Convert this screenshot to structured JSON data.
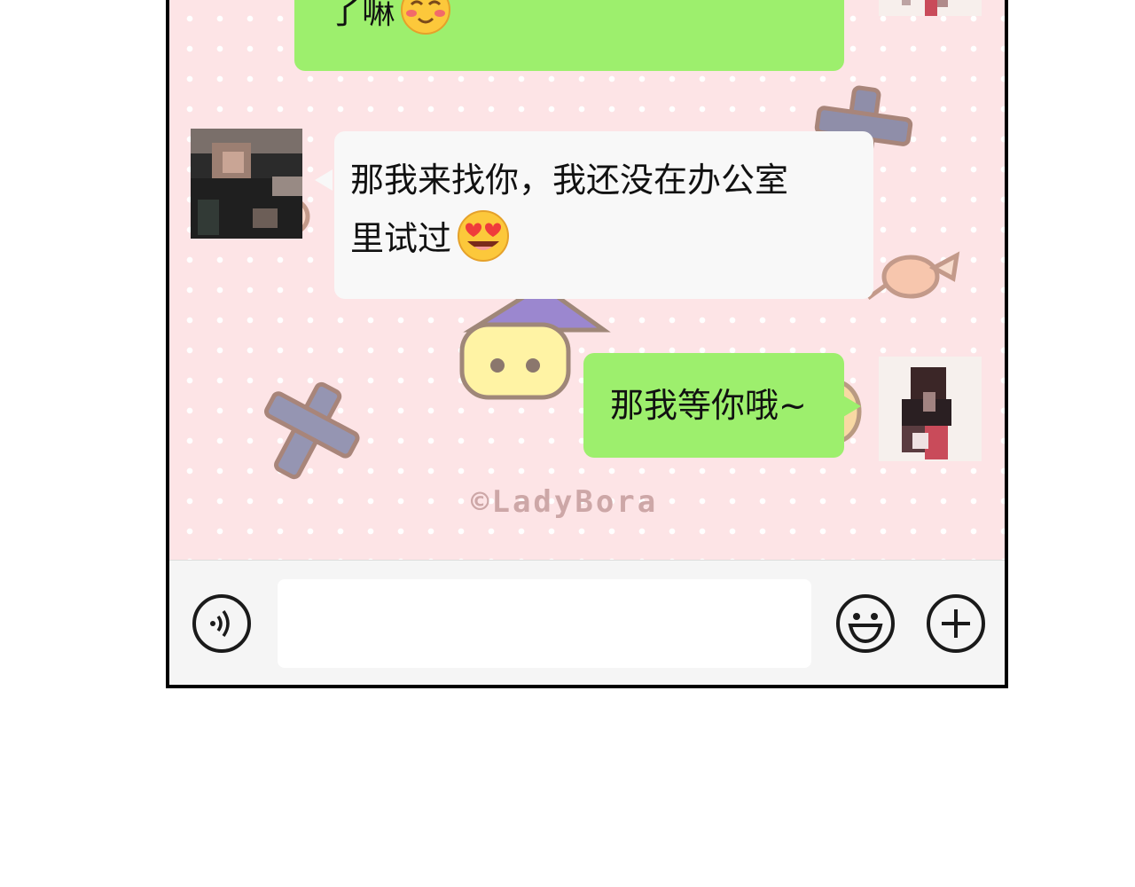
{
  "watermark": "©LadyBora",
  "messages": [
    {
      "side": "right",
      "text": "了嘛",
      "emoji": "blushing-smile-emoji"
    },
    {
      "side": "left",
      "line1": "那我来找你，我还没在办公室",
      "line2": "里试过",
      "emoji": "heart-eyes-drooling-emoji"
    },
    {
      "side": "right",
      "text": "那我等你哦~"
    }
  ],
  "input_bar": {
    "voice_icon": "voice-icon",
    "emoji_icon": "smiley-icon",
    "more_icon": "plus-icon",
    "input_value": ""
  },
  "colors": {
    "sent_bubble": "#9def6d",
    "received_bubble": "#f8f8f8",
    "chat_background": "#fde4e6",
    "input_bar_background": "#f5f5f5"
  }
}
